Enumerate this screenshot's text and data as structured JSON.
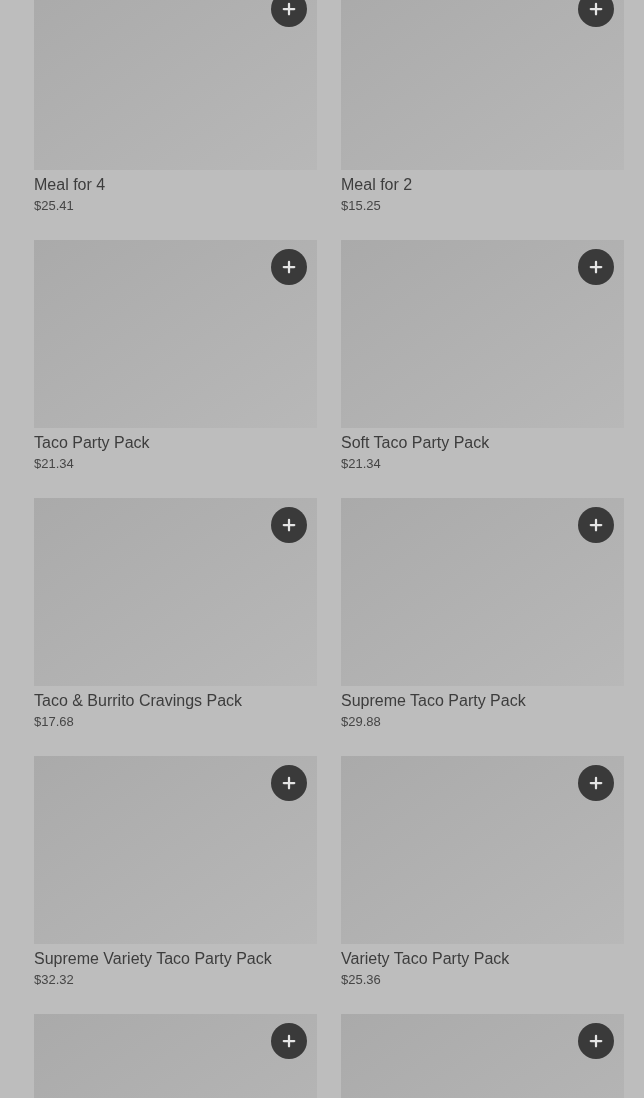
{
  "products": [
    {
      "kind": "product",
      "name": "Meal for 4",
      "price": "$25.41"
    },
    {
      "kind": "product",
      "name": "Meal for 2",
      "price": "$15.25"
    },
    {
      "kind": "product",
      "name": "Taco Party Pack",
      "price": "$21.34"
    },
    {
      "kind": "product",
      "name": "Soft Taco Party Pack",
      "price": "$21.34"
    },
    {
      "kind": "product",
      "name": "Taco & Burrito Cravings Pack",
      "price": "$17.68"
    },
    {
      "kind": "product",
      "name": "Supreme Taco Party Pack",
      "price": "$29.88"
    },
    {
      "kind": "product",
      "name": "Supreme Variety Taco Party Pack",
      "price": "$32.32"
    },
    {
      "kind": "product",
      "name": "Variety Taco Party Pack",
      "price": "$25.36"
    },
    {
      "kind": "product"
    },
    {
      "kind": "product"
    }
  ]
}
